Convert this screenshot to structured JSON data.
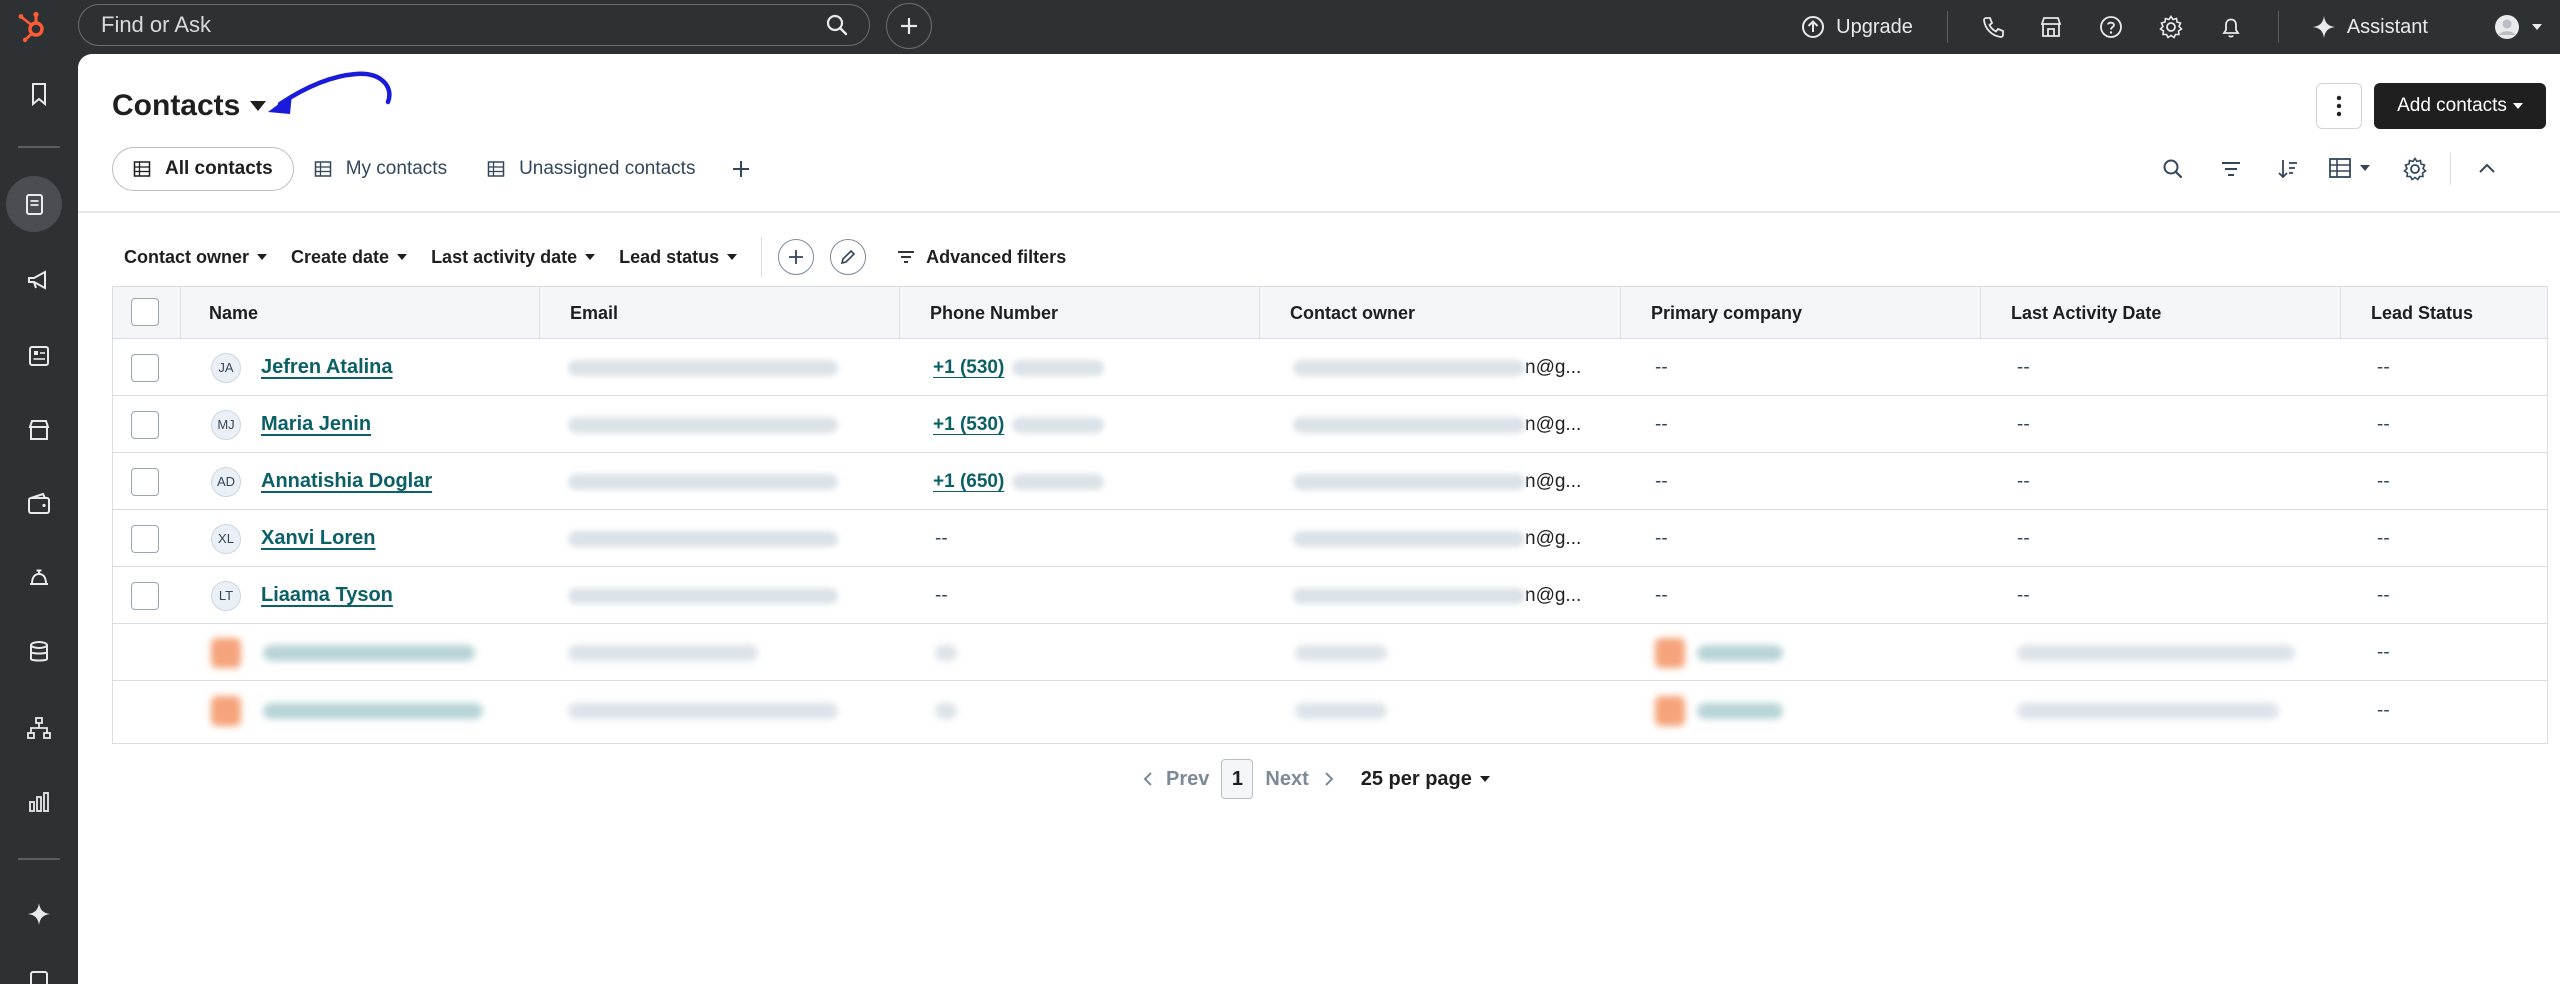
{
  "topbar": {
    "search_placeholder": "Find or Ask",
    "upgrade_label": "Upgrade",
    "assistant_label": "Assistant"
  },
  "page": {
    "title": "Contacts",
    "add_contacts_label": "Add contacts"
  },
  "views": {
    "tabs": [
      {
        "label": "All contacts",
        "active": true
      },
      {
        "label": "My contacts",
        "active": false
      },
      {
        "label": "Unassigned contacts",
        "active": false
      }
    ]
  },
  "filters": {
    "items": [
      "Contact owner",
      "Create date",
      "Last activity date",
      "Lead status"
    ],
    "advanced_label": "Advanced filters"
  },
  "table": {
    "columns": [
      "Name",
      "Email",
      "Phone Number",
      "Contact owner",
      "Primary company",
      "Last Activity Date",
      "Lead Status"
    ],
    "rows": [
      {
        "initials": "JA",
        "name": "Jefren Atalina",
        "phone": "+1 (530)",
        "owner_suffix": "n@g...",
        "company": "--",
        "last_activity": "--",
        "lead_status": "--"
      },
      {
        "initials": "MJ",
        "name": "Maria Jenin",
        "phone": "+1 (530)",
        "owner_suffix": "n@g...",
        "company": "--",
        "last_activity": "--",
        "lead_status": "--"
      },
      {
        "initials": "AD",
        "name": "Annatishia Doglar",
        "phone": "+1 (650)",
        "owner_suffix": "n@g...",
        "company": "--",
        "last_activity": "--",
        "lead_status": "--"
      },
      {
        "initials": "XL",
        "name": "Xanvi Loren",
        "phone": "--",
        "owner_suffix": "n@g...",
        "company": "--",
        "last_activity": "--",
        "lead_status": "--"
      },
      {
        "initials": "LT",
        "name": "Liaama Tyson",
        "phone": "--",
        "owner_suffix": "n@g...",
        "company": "--",
        "last_activity": "--",
        "lead_status": "--"
      }
    ],
    "blurred_rows": [
      {
        "lead_status": "--"
      },
      {
        "lead_status": "--"
      }
    ]
  },
  "pagination": {
    "prev_label": "Prev",
    "page": "1",
    "next_label": "Next",
    "per_page_label": "25 per page"
  },
  "colors": {
    "brand_orange": "#ff5c35",
    "link_teal": "#0b5f66",
    "annotation_arrow": "#1a1adb",
    "topbar_bg": "#2e3134"
  }
}
